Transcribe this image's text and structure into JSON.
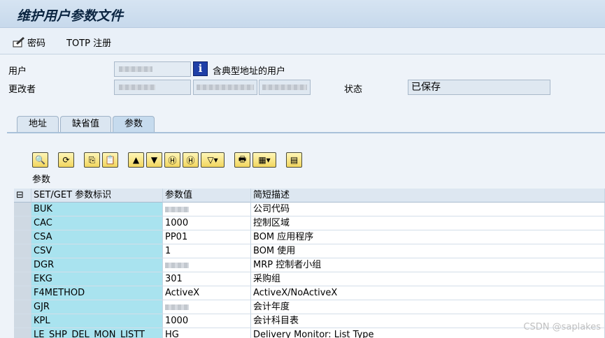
{
  "title": "维护用户参数文件",
  "appbar": {
    "password": "密码",
    "totp": "TOTP 注册"
  },
  "header": {
    "user_label": "用户",
    "info_text": "含典型地址的用户",
    "changed_by_label": "更改者",
    "status_label": "状态",
    "status_value": "已保存"
  },
  "tabs": [
    "地址",
    "缺省值",
    "参数"
  ],
  "grid": {
    "title": "参数",
    "columns": [
      "SET/GET 参数标识",
      "参数值",
      "简短描述"
    ],
    "rows": [
      {
        "id": "BUK",
        "value": "",
        "desc": "公司代码"
      },
      {
        "id": "CAC",
        "value": "1000",
        "desc": "控制区域"
      },
      {
        "id": "CSA",
        "value": "PP01",
        "desc": "BOM 应用程序"
      },
      {
        "id": "CSV",
        "value": "1",
        "desc": "BOM 使用"
      },
      {
        "id": "DGR",
        "value": "",
        "desc": "MRP 控制者小组"
      },
      {
        "id": "EKG",
        "value": "301",
        "desc": "采购组"
      },
      {
        "id": "F4METHOD",
        "value": "ActiveX",
        "desc": "ActiveX/NoActiveX"
      },
      {
        "id": "GJR",
        "value": "",
        "desc": "会计年度"
      },
      {
        "id": "KPL",
        "value": "1000",
        "desc": "会计科目表"
      },
      {
        "id": "LE_SHP_DEL_MON_LISTT",
        "value": "HG",
        "desc": "Delivery Monitor: List Type"
      }
    ]
  },
  "watermark": "CSDN @saplakes"
}
